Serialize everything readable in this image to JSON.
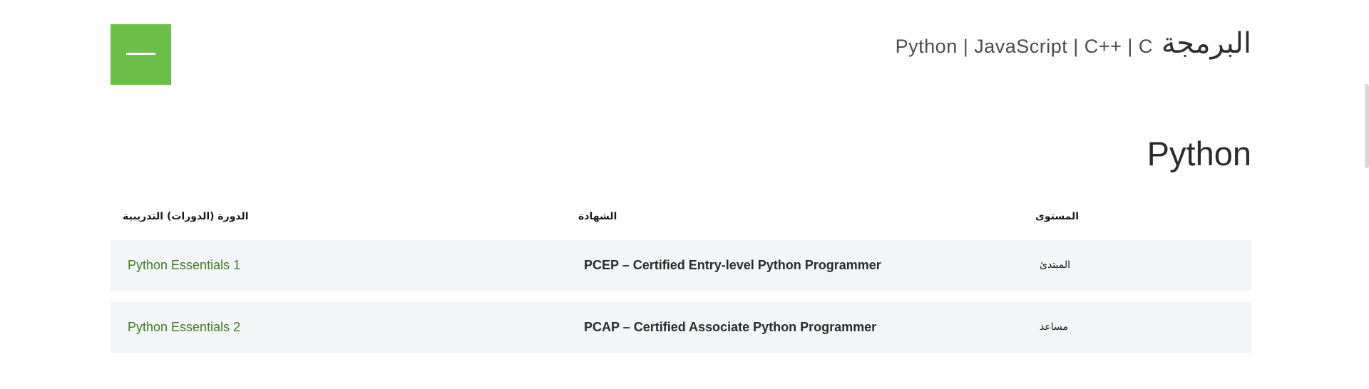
{
  "section": {
    "title_arabic": "البرمجة",
    "languages": "Python | JavaScript | C++ | C",
    "toggle_icon": "minus-icon",
    "accent_color": "#6cc04a"
  },
  "subsection": {
    "title": "Python"
  },
  "table": {
    "headers": {
      "course": "الدورة (الدورات) التدريبية",
      "certificate": "الشهادة",
      "level": "المستوى"
    },
    "rows": [
      {
        "course": "Python Essentials 1",
        "certificate": "PCEP – Certified Entry-level Python Programmer",
        "level": "المبتدئ"
      },
      {
        "course": "Python Essentials 2",
        "certificate": "PCAP – Certified Associate Python Programmer",
        "level": "مساعد"
      }
    ]
  },
  "colors": {
    "link": "#3f7a26",
    "row_background": "#f4f5f7"
  }
}
